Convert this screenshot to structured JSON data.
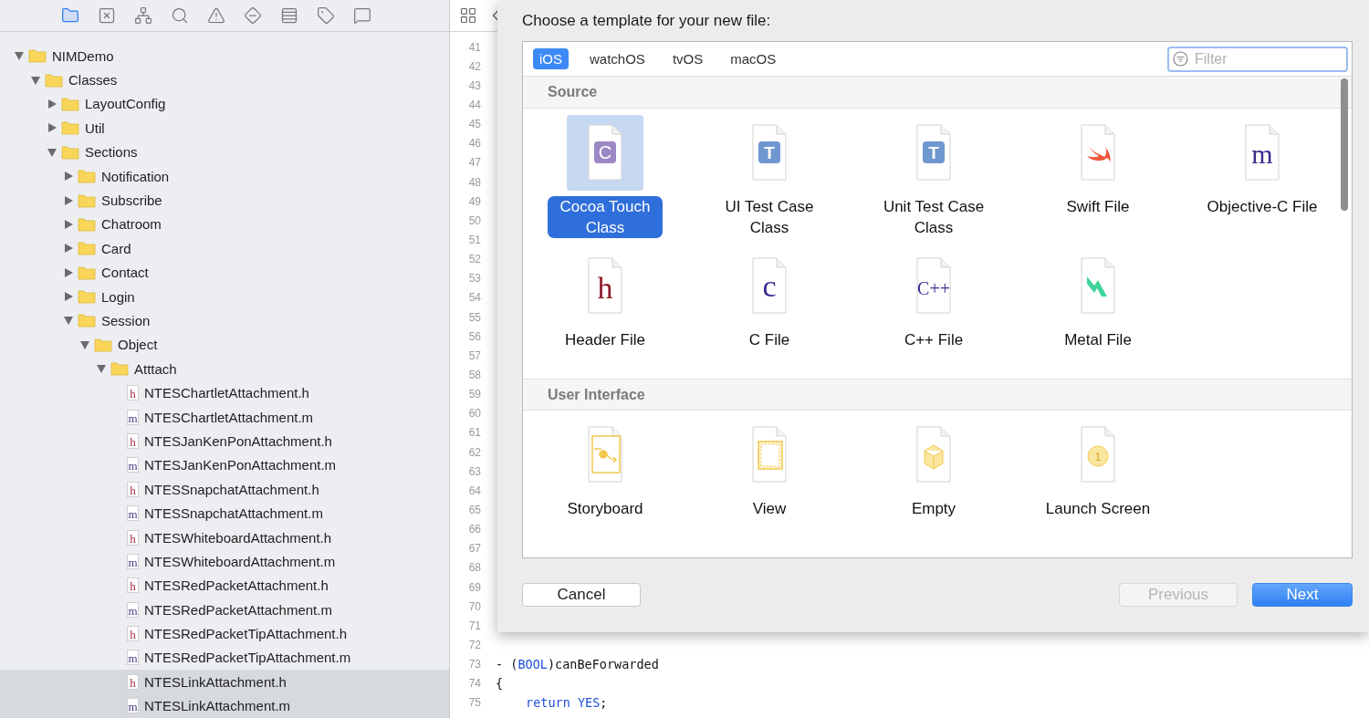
{
  "navigator_toolbar": [
    {
      "kind": "folder",
      "selected": true
    },
    {
      "kind": "source-control",
      "selected": false
    },
    {
      "kind": "hierarchy",
      "selected": false
    },
    {
      "kind": "search",
      "selected": false
    },
    {
      "kind": "warning",
      "selected": false
    },
    {
      "kind": "test",
      "selected": false
    },
    {
      "kind": "debug",
      "selected": false
    },
    {
      "kind": "breakpoint",
      "selected": false
    },
    {
      "kind": "report",
      "selected": false
    }
  ],
  "tree": [
    {
      "name": "NIMDemo",
      "kind": "folder",
      "expanded": true,
      "selected": false,
      "children": [
        {
          "name": "Classes",
          "kind": "folder",
          "expanded": true,
          "selected": false,
          "children": [
            {
              "name": "LayoutConfig",
              "kind": "folder",
              "expanded": false,
              "selected": false
            },
            {
              "name": "Util",
              "kind": "folder",
              "expanded": false,
              "selected": false
            },
            {
              "name": "Sections",
              "kind": "folder",
              "expanded": true,
              "selected": false,
              "children": [
                {
                  "name": "Notification",
                  "kind": "folder",
                  "expanded": false,
                  "selected": false
                },
                {
                  "name": "Subscribe",
                  "kind": "folder",
                  "expanded": false,
                  "selected": false
                },
                {
                  "name": "Chatroom",
                  "kind": "folder",
                  "expanded": false,
                  "selected": false
                },
                {
                  "name": "Card",
                  "kind": "folder",
                  "expanded": false,
                  "selected": false
                },
                {
                  "name": "Contact",
                  "kind": "folder",
                  "expanded": false,
                  "selected": false
                },
                {
                  "name": "Login",
                  "kind": "folder",
                  "expanded": false,
                  "selected": false
                },
                {
                  "name": "Session",
                  "kind": "folder",
                  "expanded": true,
                  "selected": false,
                  "children": [
                    {
                      "name": "Object",
                      "kind": "folder",
                      "expanded": true,
                      "selected": false,
                      "children": [
                        {
                          "name": "Atttach",
                          "kind": "folder",
                          "expanded": true,
                          "selected": false,
                          "children": [
                            {
                              "name": "NTESChartletAttachment.h",
                              "kind": "header",
                              "glyph": "h",
                              "selected": false
                            },
                            {
                              "name": "NTESChartletAttachment.m",
                              "kind": "implementation",
                              "glyph": "m",
                              "selected": false
                            },
                            {
                              "name": "NTESJanKenPonAttachment.h",
                              "kind": "header",
                              "glyph": "h",
                              "selected": false
                            },
                            {
                              "name": "NTESJanKenPonAttachment.m",
                              "kind": "implementation",
                              "glyph": "m",
                              "selected": false
                            },
                            {
                              "name": "NTESSnapchatAttachment.h",
                              "kind": "header",
                              "glyph": "h",
                              "selected": false
                            },
                            {
                              "name": "NTESSnapchatAttachment.m",
                              "kind": "implementation",
                              "glyph": "m",
                              "selected": false
                            },
                            {
                              "name": "NTESWhiteboardAttachment.h",
                              "kind": "header",
                              "glyph": "h",
                              "selected": false
                            },
                            {
                              "name": "NTESWhiteboardAttachment.m",
                              "kind": "implementation",
                              "glyph": "m",
                              "selected": false
                            },
                            {
                              "name": "NTESRedPacketAttachment.h",
                              "kind": "header",
                              "glyph": "h",
                              "selected": false
                            },
                            {
                              "name": "NTESRedPacketAttachment.m",
                              "kind": "implementation",
                              "glyph": "m",
                              "selected": false
                            },
                            {
                              "name": "NTESRedPacketTipAttachment.h",
                              "kind": "header",
                              "glyph": "h",
                              "selected": false
                            },
                            {
                              "name": "NTESRedPacketTipAttachment.m",
                              "kind": "implementation",
                              "glyph": "m",
                              "selected": false
                            },
                            {
                              "name": "NTESLinkAttachment.h",
                              "kind": "header",
                              "glyph": "h",
                              "selected": true
                            },
                            {
                              "name": "NTESLinkAttachment.m",
                              "kind": "implementation",
                              "glyph": "m",
                              "selected": true
                            }
                          ]
                        }
                      ]
                    }
                  ]
                }
              ]
            }
          ]
        }
      ]
    }
  ],
  "editor": {
    "lines": [
      {
        "number": "41"
      },
      {
        "number": "42"
      },
      {
        "number": "43"
      },
      {
        "number": "44"
      },
      {
        "number": "45"
      },
      {
        "number": "46"
      },
      {
        "number": "47"
      },
      {
        "number": "48"
      },
      {
        "number": "49"
      },
      {
        "number": "50"
      },
      {
        "number": "51"
      },
      {
        "number": "52"
      },
      {
        "number": "53"
      },
      {
        "number": "54"
      },
      {
        "number": "55"
      },
      {
        "number": "56"
      },
      {
        "number": "57"
      },
      {
        "number": "58"
      },
      {
        "number": "59"
      },
      {
        "number": "60"
      },
      {
        "number": "61"
      },
      {
        "number": "62"
      },
      {
        "number": "63"
      },
      {
        "number": "64"
      },
      {
        "number": "65"
      },
      {
        "number": "66"
      },
      {
        "number": "67"
      },
      {
        "number": "68"
      },
      {
        "number": "69"
      },
      {
        "number": "70"
      },
      {
        "number": "71"
      },
      {
        "number": "72"
      },
      {
        "number": "73",
        "code": [
          {
            "text": "- (",
            "kind": "plain"
          },
          {
            "text": "BOOL",
            "kind": "keyword"
          },
          {
            "text": ")canBeForwarded",
            "kind": "plain"
          }
        ]
      },
      {
        "number": "74",
        "code": [
          {
            "text": "{",
            "kind": "plain"
          }
        ]
      },
      {
        "number": "75",
        "indented": true,
        "code": [
          {
            "text": "return YES",
            "kind": "keyword"
          },
          {
            "text": ";",
            "kind": "plain"
          }
        ]
      }
    ]
  },
  "sheet": {
    "title": "Choose a template for your new file:",
    "platforms": [
      {
        "label": "iOS",
        "selected": true
      },
      {
        "label": "watchOS",
        "selected": false
      },
      {
        "label": "tvOS",
        "selected": false
      },
      {
        "label": "macOS",
        "selected": false
      }
    ],
    "filter": {
      "placeholder": "Filter"
    },
    "sections": [
      {
        "title": "Source",
        "templates": [
          {
            "label": "Cocoa Touch Class",
            "kind": "class",
            "glyph": "C",
            "selected": true
          },
          {
            "label": "UI Test Case Class",
            "kind": "test",
            "glyph": "T",
            "selected": false
          },
          {
            "label": "Unit Test Case Class",
            "kind": "test",
            "glyph": "T",
            "selected": false
          },
          {
            "label": "Swift File",
            "kind": "swift",
            "selected": false
          },
          {
            "label": "Objective-C File",
            "kind": "objc",
            "glyph": "m",
            "selected": false
          },
          {
            "label": "Header File",
            "kind": "header",
            "glyph": "h",
            "selected": false
          },
          {
            "label": "C File",
            "kind": "c",
            "glyph": "c",
            "selected": false
          },
          {
            "label": "C++ File",
            "kind": "cpp",
            "glyph": "C++",
            "selected": false
          },
          {
            "label": "Metal File",
            "kind": "metal",
            "selected": false
          }
        ]
      },
      {
        "title": "User Interface",
        "templates": [
          {
            "label": "Storyboard",
            "kind": "storyboard",
            "selected": false
          },
          {
            "label": "View",
            "kind": "view",
            "selected": false
          },
          {
            "label": "Empty",
            "kind": "empty",
            "selected": false
          },
          {
            "label": "Launch Screen",
            "kind": "launch",
            "glyph": "1",
            "selected": false
          }
        ]
      }
    ],
    "buttons": [
      {
        "label": "Cancel",
        "kind": "secondary",
        "disabled": false
      },
      {
        "label": "Previous",
        "kind": "secondary",
        "disabled": true
      },
      {
        "label": "Next",
        "kind": "primary",
        "disabled": false
      }
    ]
  }
}
